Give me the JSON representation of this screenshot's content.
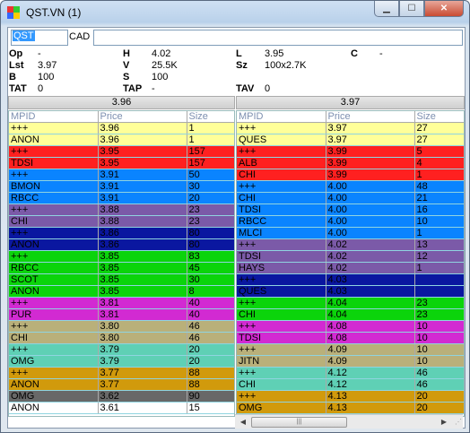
{
  "window": {
    "title": "QST.VN (1)",
    "buttons": {
      "min": "▁",
      "max": "☐",
      "close": "✕"
    }
  },
  "symbol": {
    "value": "QST",
    "exchange": "CAD",
    "extra": ""
  },
  "quote": {
    "op_label": "Op",
    "op": "-",
    "h_label": "H",
    "h": "4.02",
    "l_label": "L",
    "l": "3.95",
    "c_label": "C",
    "c": "-",
    "lst_label": "Lst",
    "lst": "3.97",
    "v_label": "V",
    "v": "25.5K",
    "sz_label": "Sz",
    "sz": "100x2.7K",
    "b_label": "B",
    "b": "100",
    "s_label": "S",
    "s": "100",
    "tat_label": "TAT",
    "tat": "0",
    "tap_label": "TAP",
    "tap": "-",
    "tav_label": "TAV",
    "tav": "0"
  },
  "bid_price": "3.96",
  "ask_price": "3.97",
  "columns": {
    "mpid": "MPID",
    "price": "Price",
    "size": "Size"
  },
  "bids": [
    {
      "mpid": "+++",
      "price": "3.96",
      "size": "1",
      "bg": "#ffff99",
      "fg": "#000000"
    },
    {
      "mpid": "ANON",
      "price": "3.96",
      "size": "1",
      "bg": "#ffff99",
      "fg": "#000000"
    },
    {
      "mpid": "+++",
      "price": "3.95",
      "size": "157",
      "bg": "#ff2020",
      "fg": "#000000"
    },
    {
      "mpid": "TDSI",
      "price": "3.95",
      "size": "157",
      "bg": "#ff2020",
      "fg": "#000000"
    },
    {
      "mpid": "+++",
      "price": "3.91",
      "size": "50",
      "bg": "#0a84ff",
      "fg": "#000000"
    },
    {
      "mpid": "BMON",
      "price": "3.91",
      "size": "30",
      "bg": "#0a84ff",
      "fg": "#000000"
    },
    {
      "mpid": "RBCC",
      "price": "3.91",
      "size": "20",
      "bg": "#0a84ff",
      "fg": "#000000"
    },
    {
      "mpid": "+++",
      "price": "3.88",
      "size": "23",
      "bg": "#7b5aa8",
      "fg": "#000000"
    },
    {
      "mpid": "CHI",
      "price": "3.88",
      "size": "23",
      "bg": "#7b5aa8",
      "fg": "#000000"
    },
    {
      "mpid": "+++",
      "price": "3.86",
      "size": "80",
      "bg": "#0a17a0",
      "fg": "#000000"
    },
    {
      "mpid": "ANON",
      "price": "3.86",
      "size": "80",
      "bg": "#0a17a0",
      "fg": "#000000"
    },
    {
      "mpid": "+++",
      "price": "3.85",
      "size": "83",
      "bg": "#0bd40b",
      "fg": "#000000"
    },
    {
      "mpid": "RBCC",
      "price": "3.85",
      "size": "45",
      "bg": "#0bd40b",
      "fg": "#000000"
    },
    {
      "mpid": "SCOT",
      "price": "3.85",
      "size": "30",
      "bg": "#0bd40b",
      "fg": "#000000"
    },
    {
      "mpid": "ANON",
      "price": "3.85",
      "size": "8",
      "bg": "#0bd40b",
      "fg": "#000000"
    },
    {
      "mpid": "+++",
      "price": "3.81",
      "size": "40",
      "bg": "#d22ad2",
      "fg": "#000000"
    },
    {
      "mpid": "PUR",
      "price": "3.81",
      "size": "40",
      "bg": "#d22ad2",
      "fg": "#000000"
    },
    {
      "mpid": "+++",
      "price": "3.80",
      "size": "46",
      "bg": "#b9b07a",
      "fg": "#000000"
    },
    {
      "mpid": "CHI",
      "price": "3.80",
      "size": "46",
      "bg": "#b9b07a",
      "fg": "#000000"
    },
    {
      "mpid": "+++",
      "price": "3.79",
      "size": "20",
      "bg": "#5fd0b5",
      "fg": "#000000"
    },
    {
      "mpid": "OMG",
      "price": "3.79",
      "size": "20",
      "bg": "#5fd0b5",
      "fg": "#000000"
    },
    {
      "mpid": "+++",
      "price": "3.77",
      "size": "88",
      "bg": "#d19a0c",
      "fg": "#000000"
    },
    {
      "mpid": "ANON",
      "price": "3.77",
      "size": "88",
      "bg": "#d19a0c",
      "fg": "#000000"
    },
    {
      "mpid": "OMG",
      "price": "3.62",
      "size": "90",
      "bg": "#686868",
      "fg": "#000000"
    },
    {
      "mpid": "ANON",
      "price": "3.61",
      "size": "15",
      "bg": "#ffffff",
      "fg": "#000000"
    }
  ],
  "asks": [
    {
      "mpid": "+++",
      "price": "3.97",
      "size": "27",
      "bg": "#ffff99",
      "fg": "#000000"
    },
    {
      "mpid": "QUES",
      "price": "3.97",
      "size": "27",
      "bg": "#ffff99",
      "fg": "#000000"
    },
    {
      "mpid": "+++",
      "price": "3.99",
      "size": "5",
      "bg": "#ff2020",
      "fg": "#000000"
    },
    {
      "mpid": "ALB",
      "price": "3.99",
      "size": "4",
      "bg": "#ff2020",
      "fg": "#000000"
    },
    {
      "mpid": "CHI",
      "price": "3.99",
      "size": "1",
      "bg": "#ff2020",
      "fg": "#000000"
    },
    {
      "mpid": "+++",
      "price": "4.00",
      "size": "48",
      "bg": "#0a84ff",
      "fg": "#000000"
    },
    {
      "mpid": "CHI",
      "price": "4.00",
      "size": "21",
      "bg": "#0a84ff",
      "fg": "#000000"
    },
    {
      "mpid": "TDSI",
      "price": "4.00",
      "size": "16",
      "bg": "#0a84ff",
      "fg": "#000000"
    },
    {
      "mpid": "RBCC",
      "price": "4.00",
      "size": "10",
      "bg": "#0a84ff",
      "fg": "#000000"
    },
    {
      "mpid": "MLCI",
      "price": "4.00",
      "size": "1",
      "bg": "#0a84ff",
      "fg": "#000000"
    },
    {
      "mpid": "+++",
      "price": "4.02",
      "size": "13",
      "bg": "#7b5aa8",
      "fg": "#000000"
    },
    {
      "mpid": "TDSI",
      "price": "4.02",
      "size": "12",
      "bg": "#7b5aa8",
      "fg": "#000000"
    },
    {
      "mpid": "HAYS",
      "price": "4.02",
      "size": "1",
      "bg": "#7b5aa8",
      "fg": "#000000"
    },
    {
      "mpid": "+++",
      "price": "4.03",
      "size": "",
      "bg": "#0a17a0",
      "fg": "#000000"
    },
    {
      "mpid": "QUES",
      "price": "4.03",
      "size": "",
      "bg": "#0a17a0",
      "fg": "#000000"
    },
    {
      "mpid": "+++",
      "price": "4.04",
      "size": "23",
      "bg": "#0bd40b",
      "fg": "#000000"
    },
    {
      "mpid": "CHI",
      "price": "4.04",
      "size": "23",
      "bg": "#0bd40b",
      "fg": "#000000"
    },
    {
      "mpid": "+++",
      "price": "4.08",
      "size": "10",
      "bg": "#d22ad2",
      "fg": "#000000"
    },
    {
      "mpid": "TDSI",
      "price": "4.08",
      "size": "10",
      "bg": "#d22ad2",
      "fg": "#000000"
    },
    {
      "mpid": "+++",
      "price": "4.09",
      "size": "10",
      "bg": "#b9b07a",
      "fg": "#000000"
    },
    {
      "mpid": "JITN",
      "price": "4.09",
      "size": "10",
      "bg": "#b9b07a",
      "fg": "#000000"
    },
    {
      "mpid": "+++",
      "price": "4.12",
      "size": "46",
      "bg": "#5fd0b5",
      "fg": "#000000"
    },
    {
      "mpid": "CHI",
      "price": "4.12",
      "size": "46",
      "bg": "#5fd0b5",
      "fg": "#000000"
    },
    {
      "mpid": "+++",
      "price": "4.13",
      "size": "20",
      "bg": "#d19a0c",
      "fg": "#000000"
    },
    {
      "mpid": "OMG",
      "price": "4.13",
      "size": "20",
      "bg": "#d19a0c",
      "fg": "#000000"
    }
  ]
}
